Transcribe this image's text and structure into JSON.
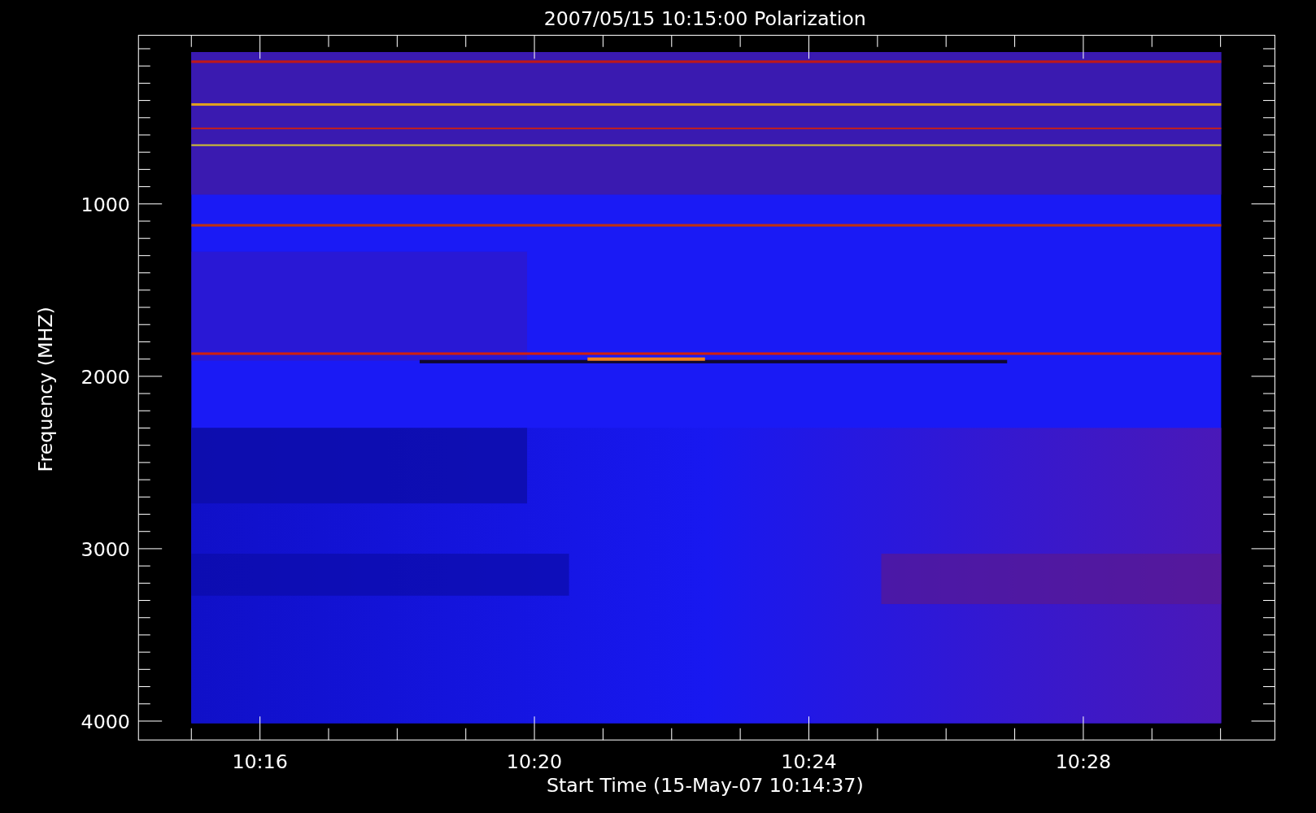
{
  "title": "2007/05/15 10:15:00 Polarization",
  "y_axis": {
    "label": "Frequency (MHZ)",
    "ticks": [
      "1000",
      "2000",
      "3000",
      "4000"
    ]
  },
  "x_axis": {
    "label": "Start Time (15-May-07 10:14:37)",
    "ticks": [
      "10:16",
      "10:20",
      "10:24",
      "10:28"
    ]
  }
}
